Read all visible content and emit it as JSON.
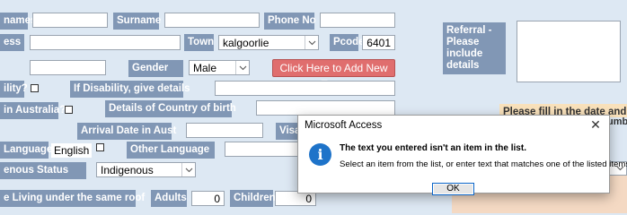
{
  "form": {
    "surname_label_clip": "names",
    "surname_label": "Surname",
    "phone_label": "Phone No",
    "address_label_clip": "ess",
    "town_label": "Town",
    "town_value": "kalgoorlie",
    "pcode_label": "Pcode",
    "pcode_value": "6401",
    "gender_label": "Gender",
    "gender_value": "Male",
    "add_town_button": "Click Here to Add New Town",
    "referral_label": "Referral - Please include details",
    "disability_label_clip": "ility?",
    "disability_details_label": "If Disability, give details",
    "in_australia_label_clip": "in Australia?",
    "country_birth_label": "Details of Country of birth",
    "arrival_date_label": "Arrival Date in Aust",
    "visa_label_clip": "Visa",
    "hint_text": "Please fill in the date and deta",
    "hint_text2": "umb",
    "language_label_clip": "Language",
    "language_value": "English",
    "other_language_label": "Other Language",
    "indigenous_label_clip": "enous Status",
    "indigenous_value": "Indigenous",
    "living_label_clip": "e Living under the same roof",
    "adults_label": "Adults",
    "adults_value": "0",
    "children_label": "Children",
    "children_value": "0"
  },
  "dialog": {
    "title": "Microsoft Access",
    "message": "The text you entered isn't an item in the list.",
    "detail": "Select an item from the list, or enter text that matches one of the listed items.",
    "ok_label": "OK",
    "close_glyph": "✕",
    "icon_glyph": "i"
  }
}
